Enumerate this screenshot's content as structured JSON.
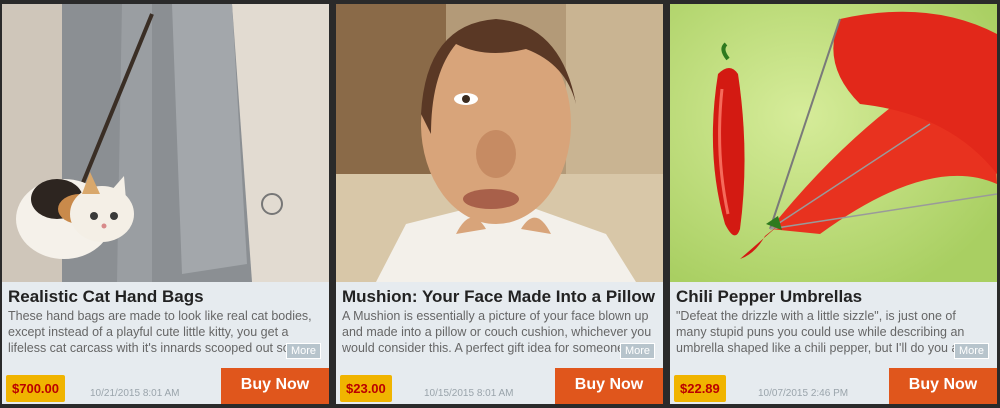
{
  "cards": [
    {
      "title": "Realistic Cat Hand Bags",
      "description": "These hand bags are made to look like real cat bodies, except instead of a playful cute little kitty, you get a lifeless cat carcass with it's innards scooped out so...",
      "more_label": "More",
      "price": "$700.00",
      "date": "10/21/2015 8:01 AM",
      "buy_label": "Buy Now"
    },
    {
      "title": "Mushion: Your Face Made Into a Pillow",
      "description": "A Mushion is essentially a picture of your face blown up and made into a pillow or couch cushion, whichever you would consider this. A perfect gift idea for someone...",
      "more_label": "More",
      "price": "$23.00",
      "date": "10/15/2015 8:01 AM",
      "buy_label": "Buy Now"
    },
    {
      "title": "Chili Pepper Umbrellas",
      "description": "\"Defeat the drizzle with a little sizzle\", is just one of many stupid puns you could use while describing an umbrella shaped like a chili pepper, but I'll do you a favor and...",
      "more_label": "More",
      "price": "$22.89",
      "date": "10/07/2015 2:46 PM",
      "buy_label": "Buy Now"
    }
  ],
  "colors": {
    "buy_button": "#e0561c",
    "price_tag": "#f0b400",
    "price_text": "#bb0000",
    "card_bg": "#e6ebef"
  }
}
